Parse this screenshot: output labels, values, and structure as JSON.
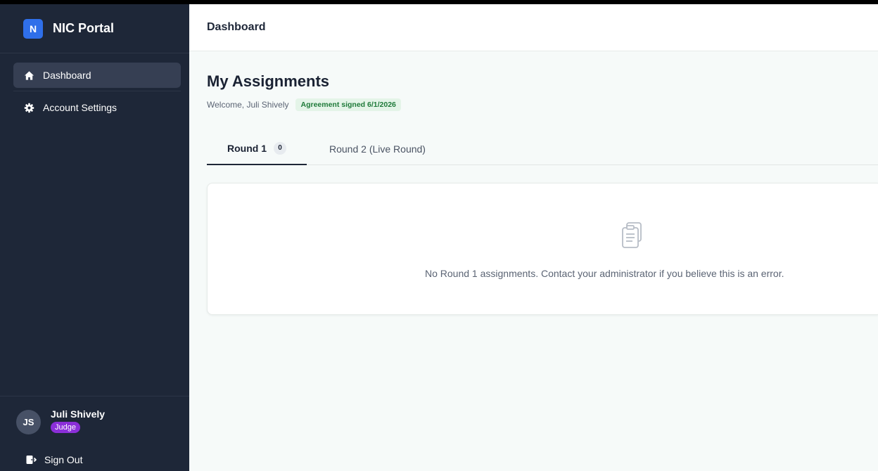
{
  "brand": {
    "logo_letter": "N",
    "name": "NIC Portal"
  },
  "nav": {
    "items": [
      {
        "label": "Dashboard",
        "icon": "home-icon",
        "active": true
      },
      {
        "label": "Account Settings",
        "icon": "gear-icon",
        "active": false
      }
    ]
  },
  "user": {
    "initials": "JS",
    "name": "Juli Shively",
    "role": "Judge"
  },
  "signout": {
    "label": "Sign Out",
    "icon": "sign-out-icon"
  },
  "header": {
    "title": "Dashboard"
  },
  "page": {
    "title": "My Assignments",
    "welcome": "Welcome, Juli Shively",
    "agreement_badge": "Agreement signed 6/1/2026"
  },
  "tabs": [
    {
      "label": "Round 1",
      "count": "0",
      "active": true
    },
    {
      "label": "Round 2 (Live Round)",
      "active": false
    }
  ],
  "empty_state": {
    "icon": "clipboard-icon",
    "message": "No Round 1 assignments. Contact your administrator if you believe this is an error."
  },
  "colors": {
    "sidebar_bg": "#1e2738",
    "active_nav_bg": "#363f53",
    "brand_accent": "#2f6fea",
    "role_badge": "#8b2fd8",
    "agreement_badge_bg": "#e4f4e8",
    "agreement_badge_text": "#1f7a3a"
  }
}
